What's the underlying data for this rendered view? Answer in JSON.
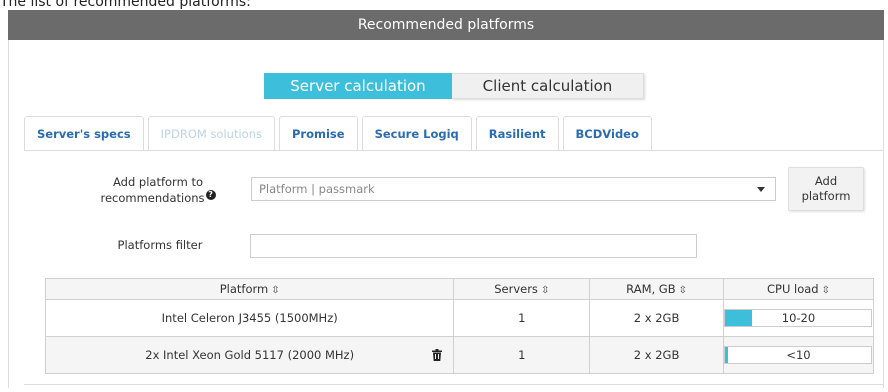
{
  "caption": "The list of recommended platforms:",
  "header": {
    "title": "Recommended platforms"
  },
  "calc_toggle": {
    "server_label": "Server calculation",
    "client_label": "Client calculation"
  },
  "tabs": [
    {
      "label": "Server's specs",
      "state": "active"
    },
    {
      "label": "IPDROM solutions",
      "state": "disabled"
    },
    {
      "label": "Promise",
      "state": "normal"
    },
    {
      "label": "Secure Logiq",
      "state": "normal"
    },
    {
      "label": "Rasilient",
      "state": "normal"
    },
    {
      "label": "BCDVideo",
      "state": "normal"
    }
  ],
  "add_platform": {
    "label_line1": "Add platform to",
    "label_line2": "recommendations",
    "help_icon": "?",
    "select_placeholder": "Platform | passmark",
    "button_line1": "Add",
    "button_line2": "platform"
  },
  "filter": {
    "label": "Platforms filter",
    "value": ""
  },
  "table": {
    "columns": [
      "Platform",
      "Servers",
      "RAM, GB",
      "CPU load"
    ],
    "sort_glyph": "⇳",
    "rows": [
      {
        "platform": "Intel Celeron J3455 (1500MHz)",
        "servers": "1",
        "ram": "2 x 2GB",
        "cpu_label": "10-20",
        "cpu_fraction": 0.18,
        "deletable": false
      },
      {
        "platform": "2x Intel Xeon Gold 5117 (2000 MHz)",
        "servers": "1",
        "ram": "2 x 2GB",
        "cpu_label": "<10",
        "cpu_fraction": 0.02,
        "deletable": true
      }
    ]
  },
  "colors": {
    "accent": "#3dbfdc",
    "header_bg": "#6b6b6b",
    "tab_text": "#2b6cb0"
  }
}
